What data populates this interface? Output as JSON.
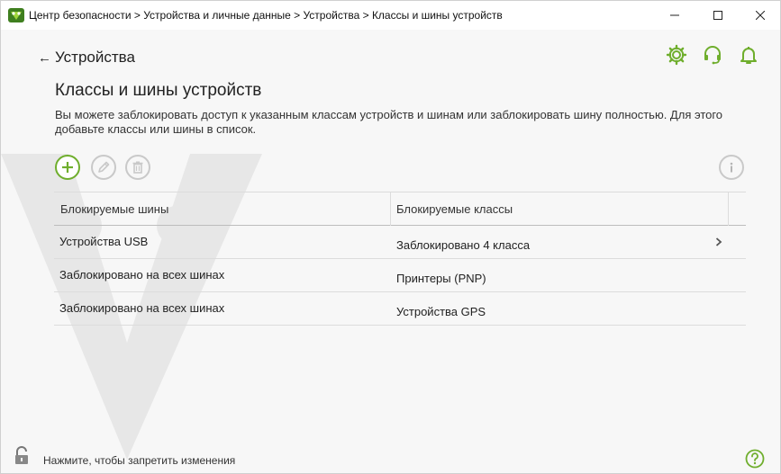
{
  "window": {
    "title": "Центр безопасности > Устройства и личные данные > Устройства > Классы и шины устройств"
  },
  "nav": {
    "back_label": "Устройства"
  },
  "page": {
    "title": "Классы и шины устройств",
    "description": "Вы можете заблокировать доступ к указанным классам устройств и шинам или заблокировать шину полностью. Для этого добавьте классы или шины в список."
  },
  "table": {
    "columns": [
      "Блокируемые шины",
      "Блокируемые классы"
    ],
    "rows": [
      {
        "bus": "Устройства USB",
        "classes": "Заблокировано 4 класса",
        "has_details": true
      },
      {
        "bus": "Заблокировано на всех шинах",
        "classes": "Принтеры (PNP)",
        "has_details": false
      },
      {
        "bus": "Заблокировано на всех шинах",
        "classes": "Устройства GPS",
        "has_details": false
      }
    ]
  },
  "footer": {
    "lock_text": "Нажмите, чтобы запретить изменения"
  },
  "colors": {
    "accent": "#6fae2d",
    "disabled": "#c9c9c9"
  },
  "icons": {
    "toolbar": [
      "add-icon",
      "edit-icon",
      "delete-icon",
      "info-icon"
    ],
    "top": [
      "gear-icon",
      "support-headset-icon",
      "bell-icon"
    ]
  }
}
